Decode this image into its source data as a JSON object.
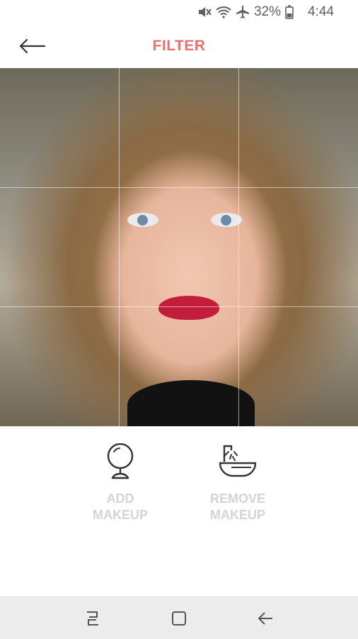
{
  "status_bar": {
    "icons": [
      "mute-icon",
      "wifi-icon",
      "airplane-icon",
      "battery-icon"
    ],
    "battery": "32%",
    "time": "4:44"
  },
  "app_bar": {
    "title": "FILTER",
    "back_icon": "arrow-left-icon",
    "title_color": "#e57373"
  },
  "photo": {
    "grid": true
  },
  "actions": [
    {
      "icon": "mirror-icon",
      "label": "ADD\nMAKEUP"
    },
    {
      "icon": "sink-icon",
      "label": "REMOVE\nMAKEUP"
    }
  ],
  "nav_bar": {
    "buttons": [
      "recents-icon",
      "home-icon",
      "back-icon"
    ]
  }
}
